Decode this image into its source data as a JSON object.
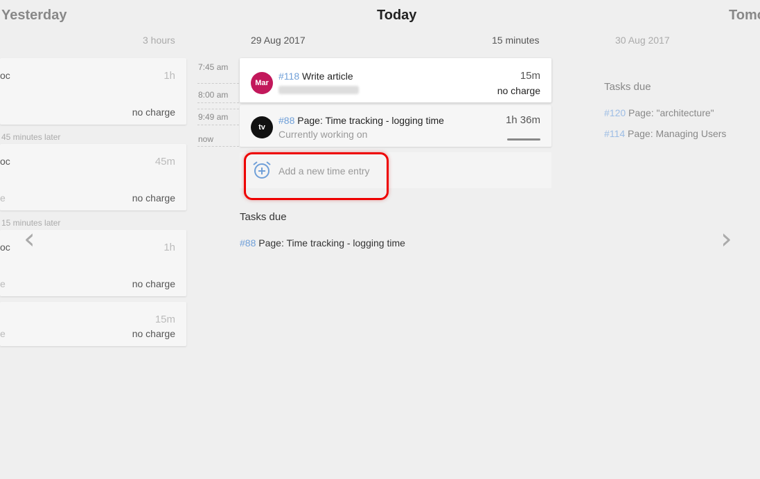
{
  "columns": {
    "yesterday": {
      "title": "Yesterday",
      "summary": "3 hours"
    },
    "today": {
      "title": "Today",
      "date": "29 Aug 2017",
      "summary": "15 minutes"
    },
    "tomorrow": {
      "title": "Tomo",
      "date": "30 Aug 2017"
    }
  },
  "yesterday_entries": [
    {
      "title_fragment": "oc",
      "duration": "1h",
      "sub_fragment": "",
      "charge": "no charge"
    },
    {
      "title_fragment": "oc",
      "duration": "45m",
      "sub_fragment": "e",
      "charge": "no charge"
    },
    {
      "title_fragment": "oc",
      "duration": "1h",
      "sub_fragment": "e",
      "charge": "no charge"
    },
    {
      "title_fragment": "",
      "duration": "15m",
      "sub_fragment": "e",
      "charge": "no charge"
    }
  ],
  "yesterday_gaps": [
    "45 minutes later",
    "15 minutes later"
  ],
  "timeline": [
    "7:45 am",
    "8:00 am",
    "9:49 am",
    "now"
  ],
  "today_entries": [
    {
      "avatar": "Mar",
      "avatar_color": "#c2185b",
      "task_id": "#118",
      "title": "Write article",
      "duration": "15m",
      "charge": "no charge"
    },
    {
      "avatar": "tv",
      "avatar_color": "#111111",
      "task_id": "#88",
      "title": "Page: Time tracking - logging time",
      "duration": "1h 36m",
      "status": "Currently working on"
    }
  ],
  "add_entry": {
    "label": "Add a new time entry",
    "icon": "alarm-add-icon"
  },
  "today_tasks_due": {
    "heading": "Tasks due",
    "items": [
      {
        "id": "#88",
        "title": "Page: Time tracking - logging time"
      }
    ]
  },
  "tomorrow_tasks_due": {
    "heading": "Tasks due",
    "items": [
      {
        "id": "#120",
        "title": "Page: \"architecture\""
      },
      {
        "id": "#114",
        "title": "Page: Managing Users"
      }
    ]
  },
  "nav": {
    "prev": "‹",
    "next": "›"
  },
  "colors": {
    "accent": "#6f9fd8",
    "highlight": "#e00000"
  }
}
